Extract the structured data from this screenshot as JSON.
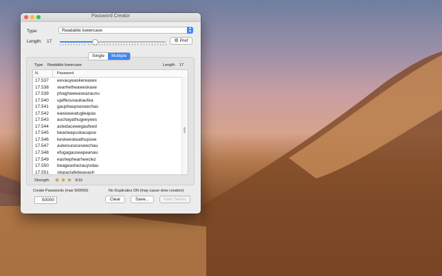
{
  "window": {
    "title": "Password Creator"
  },
  "type_label": "Type:",
  "type_select": {
    "value": "Readable lowercase"
  },
  "length_label": "Length:",
  "length_value": "17",
  "slider": {
    "fraction": 0.33
  },
  "pref_button": "Pref",
  "mode_tabs": [
    "Single",
    "Multiple"
  ],
  "list_info": {
    "type_text": "Type:",
    "type_value": "Readable lowercase",
    "length_text": "Length:",
    "length_value": "17"
  },
  "table": {
    "headers": [
      "N.",
      "Password"
    ],
    "rows": [
      [
        "17.537",
        "eevauyeaskereaxex"
      ],
      [
        "17.538",
        "xearhetheaweskaxe"
      ],
      [
        "17.539",
        "phaghaweaseazaunu"
      ],
      [
        "17.540",
        "ujaffecuxaukaufea"
      ],
      [
        "17.541",
        "gauphaupseceechas"
      ],
      [
        "17.542",
        "eaxeaseatugleapas"
      ],
      [
        "17.543",
        "auchayathugeeyees"
      ],
      [
        "17.544",
        "acledacewegaufeed"
      ],
      [
        "17.545",
        "beacleayuskacapse"
      ],
      [
        "17.546",
        "keskeeskeathupsee"
      ],
      [
        "17.547",
        "aukesuceceseechau"
      ],
      [
        "17.548",
        "efugagauseapeanau"
      ],
      [
        "17.549",
        "eashephearheeclez"
      ],
      [
        "17.550",
        "beageashezauyudau"
      ],
      [
        "17.551",
        "stepaclafebeaxash"
      ]
    ]
  },
  "strength": {
    "label": "Strength:",
    "stars_filled": 3,
    "text": "3/10",
    "star_color": "#c9a227"
  },
  "create_label": "Create Passwords (max 500000)",
  "duplicates_note": "No Duplicates ON (may cause slow creation)",
  "count_input": {
    "value": "50000"
  },
  "buttons": {
    "clear": "Clear",
    "save": "Save...",
    "new_series": "New Series"
  },
  "colors": {
    "accent": "#3d86f5"
  }
}
